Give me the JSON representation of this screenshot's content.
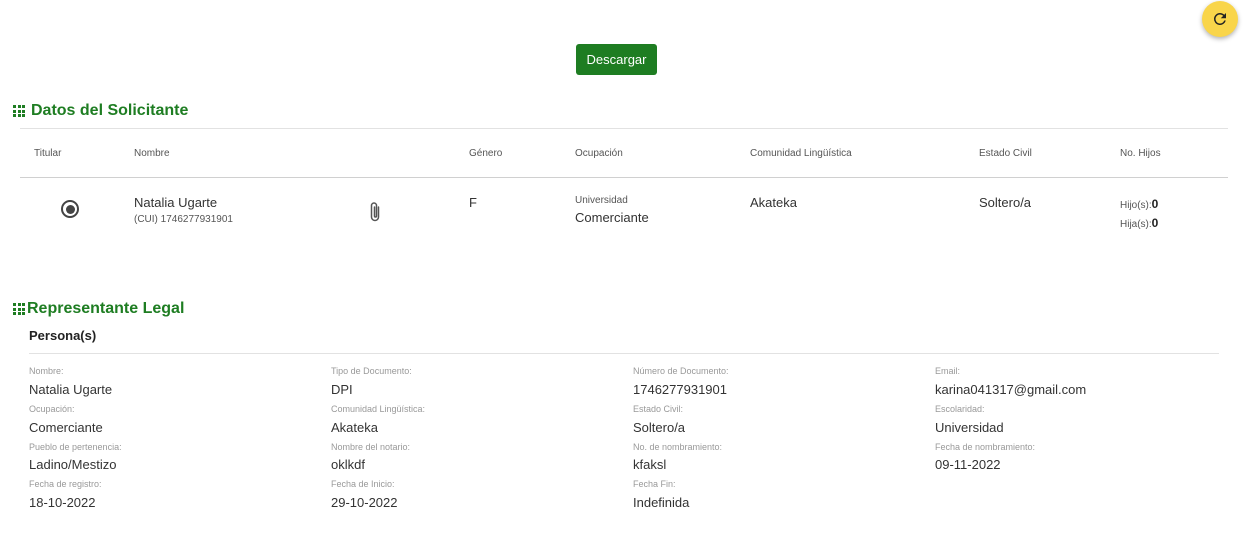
{
  "toolbar": {
    "download_label": "Descargar"
  },
  "solicitante": {
    "title": "Datos del Solicitante",
    "headers": {
      "titular": "Titular",
      "nombre": "Nombre",
      "genero": "Género",
      "ocupacion": "Ocupación",
      "comunidad": "Comunidad Lingüística",
      "estado": "Estado Civil",
      "hijos": "No. Hijos"
    },
    "row": {
      "nombre": "Natalia Ugarte",
      "cui": "(CUI) 1746277931901",
      "genero": "F",
      "escolaridad": "Universidad",
      "ocupacion": "Comerciante",
      "comunidad": "Akateka",
      "estado": "Soltero/a",
      "hijos_label": "Hijo(s):",
      "hijos_value": "0",
      "hijas_label": "Hija(s):",
      "hijas_value": "0"
    }
  },
  "representante": {
    "title": "Representante Legal",
    "subtitle": "Persona(s)",
    "fields": {
      "nombre": {
        "label": "Nombre:",
        "value": "Natalia Ugarte"
      },
      "tipo_doc": {
        "label": "Tipo de Documento:",
        "value": "DPI"
      },
      "num_doc": {
        "label": "Número de Documento:",
        "value": "1746277931901"
      },
      "email": {
        "label": "Email:",
        "value": "karina041317@gmail.com"
      },
      "ocupacion": {
        "label": "Ocupación:",
        "value": "Comerciante"
      },
      "comunidad": {
        "label": "Comunidad Lingüística:",
        "value": "Akateka"
      },
      "estado": {
        "label": "Estado Civil:",
        "value": "Soltero/a"
      },
      "escolaridad": {
        "label": "Escolaridad:",
        "value": "Universidad"
      },
      "pueblo": {
        "label": "Pueblo de pertenencia:",
        "value": "Ladino/Mestizo"
      },
      "notario": {
        "label": "Nombre del notario:",
        "value": "oklkdf"
      },
      "nombramiento": {
        "label": "No. de nombramiento:",
        "value": "kfaksl"
      },
      "fecha_nombramiento": {
        "label": "Fecha de nombramiento:",
        "value": "09-11-2022"
      },
      "fecha_registro": {
        "label": "Fecha de registro:",
        "value": "18-10-2022"
      },
      "fecha_inicio": {
        "label": "Fecha de Inicio:",
        "value": "29-10-2022"
      },
      "fecha_fin": {
        "label": "Fecha Fin:",
        "value": "Indefinida"
      }
    }
  },
  "icons": {
    "refresh": "refresh-icon",
    "attachment": "paperclip-icon",
    "section": "grid-icon"
  },
  "colors": {
    "accent": "#1e7d22",
    "fab": "#f9d54a"
  }
}
